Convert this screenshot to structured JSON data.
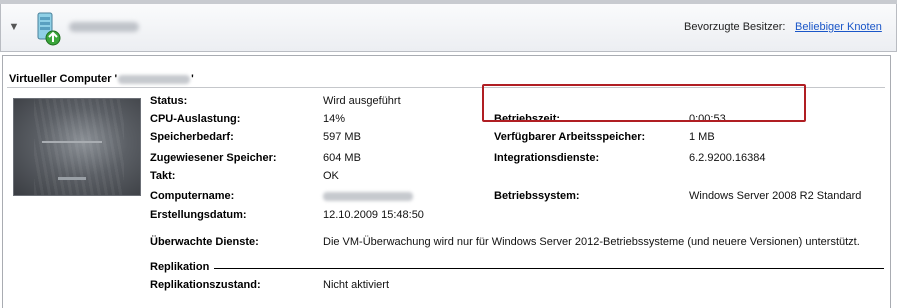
{
  "header": {
    "owner_label": "Bevorzugte Besitzer:",
    "owner_link": "Beliebiger Knoten"
  },
  "vm": {
    "title_prefix": "Virtueller Computer '",
    "title_suffix": "'"
  },
  "details": {
    "status_label": "Status:",
    "status_value": "Wird ausgeführt",
    "cpu_label": "CPU-Auslastung:",
    "cpu_value": "14%",
    "memdemand_label": "Speicherbedarf:",
    "memdemand_value": "597 MB",
    "assigned_label": "Zugewiesener Speicher:",
    "assigned_value": "604 MB",
    "heartbeat_label": "Takt:",
    "heartbeat_value": "OK",
    "computername_label": "Computername:",
    "created_label": "Erstellungsdatum:",
    "created_value": "12.10.2009 15:48:50",
    "uptime_label": "Betriebszeit:",
    "uptime_value": "0:00:53",
    "available_label": "Verfügbarer Arbeitsspeicher:",
    "available_value": "1 MB",
    "integration_label": "Integrationsdienste:",
    "integration_value": "6.2.9200.16384",
    "os_label": "Betriebssystem:",
    "os_value": "Windows Server 2008 R2 Standard",
    "monitored_label": "Überwachte Dienste:",
    "monitored_value": "Die VM-Überwachung wird nur für Windows Server 2012-Betriebssysteme (und neuere Versionen) unterstützt."
  },
  "replication": {
    "section_title": "Replikation",
    "state_label": "Replikationszustand:",
    "state_value": "Nicht aktiviert"
  },
  "colors": {
    "link": "#1a56c8",
    "highlight_border": "#b01e23"
  },
  "icons": {
    "collapse": "chevron-down-icon",
    "server": "server-icon"
  }
}
